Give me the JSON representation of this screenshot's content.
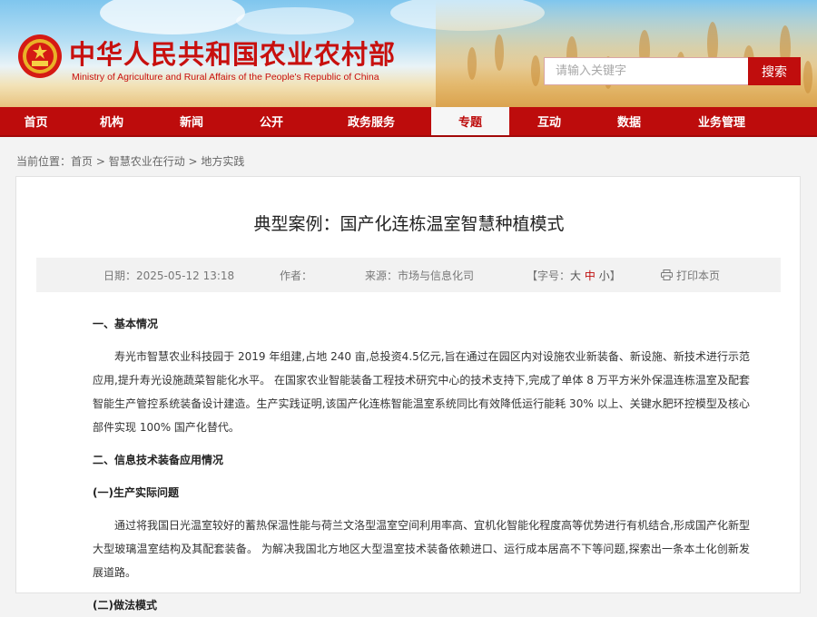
{
  "header": {
    "site_title": "中华人民共和国农业农村部",
    "site_subtitle": "Ministry of Agriculture and Rural Affairs of the People's Republic of China",
    "emblem_icon": "national-emblem-icon",
    "search": {
      "placeholder": "请输入关键字",
      "button_label": "搜索"
    },
    "colors": {
      "brand_red": "#c00d0d",
      "nav_red": "#bd0c0c"
    }
  },
  "nav": {
    "items": [
      {
        "label": "首页",
        "active": false
      },
      {
        "label": "机构",
        "active": false
      },
      {
        "label": "新闻",
        "active": false
      },
      {
        "label": "公开",
        "active": false
      },
      {
        "label": "政务服务",
        "active": false
      },
      {
        "label": "专题",
        "active": true
      },
      {
        "label": "互动",
        "active": false
      },
      {
        "label": "数据",
        "active": false
      },
      {
        "label": "业务管理",
        "active": false
      }
    ]
  },
  "breadcrumb": {
    "prefix": "当前位置：",
    "items": [
      "首页",
      "智慧农业在行动",
      "地方实践"
    ],
    "separator": " > "
  },
  "article": {
    "title": "典型案例：国产化连栋温室智慧种植模式",
    "meta": {
      "date_label": "日期：",
      "date": "2025-05-12 13:18",
      "author_label": "作者：",
      "author": "",
      "source_label": "来源：",
      "source": "市场与信息化司",
      "font_size_open": "【字号：",
      "font_size_big": "大",
      "font_size_mid": "中",
      "font_size_small": "小",
      "font_size_close": "】",
      "print_label": "打印本页",
      "print_icon": "printer-icon"
    },
    "sections": {
      "h1": "一、基本情况",
      "p1": "寿光市智慧农业科技园于 2019 年组建,占地 240 亩,总投资4.5亿元,旨在通过在园区内对设施农业新装备、新设施、新技术进行示范应用,提升寿光设施蔬菜智能化水平。 在国家农业智能装备工程技术研究中心的技术支持下,完成了单体 8 万平方米外保温连栋温室及配套智能生产管控系统装备设计建造。生产实践证明,该国产化连栋智能温室系统同比有效降低运行能耗 30% 以上、关键水肥环控模型及核心部件实现 100% 国产化替代。",
      "h2": "二、信息技术装备应用情况",
      "h2_1": "(一)生产实际问题",
      "p2": "通过将我国日光温室较好的蓄热保温性能与荷兰文洛型温室空间利用率高、宜机化智能化程度高等优势进行有机结合,形成国产化新型大型玻璃温室结构及其配套装备。 为解决我国北方地区大型温室技术装备依赖进口、运行成本居高不下等问题,探索出一条本土化创新发展道路。",
      "h2_2": "(二)做法模式"
    }
  }
}
